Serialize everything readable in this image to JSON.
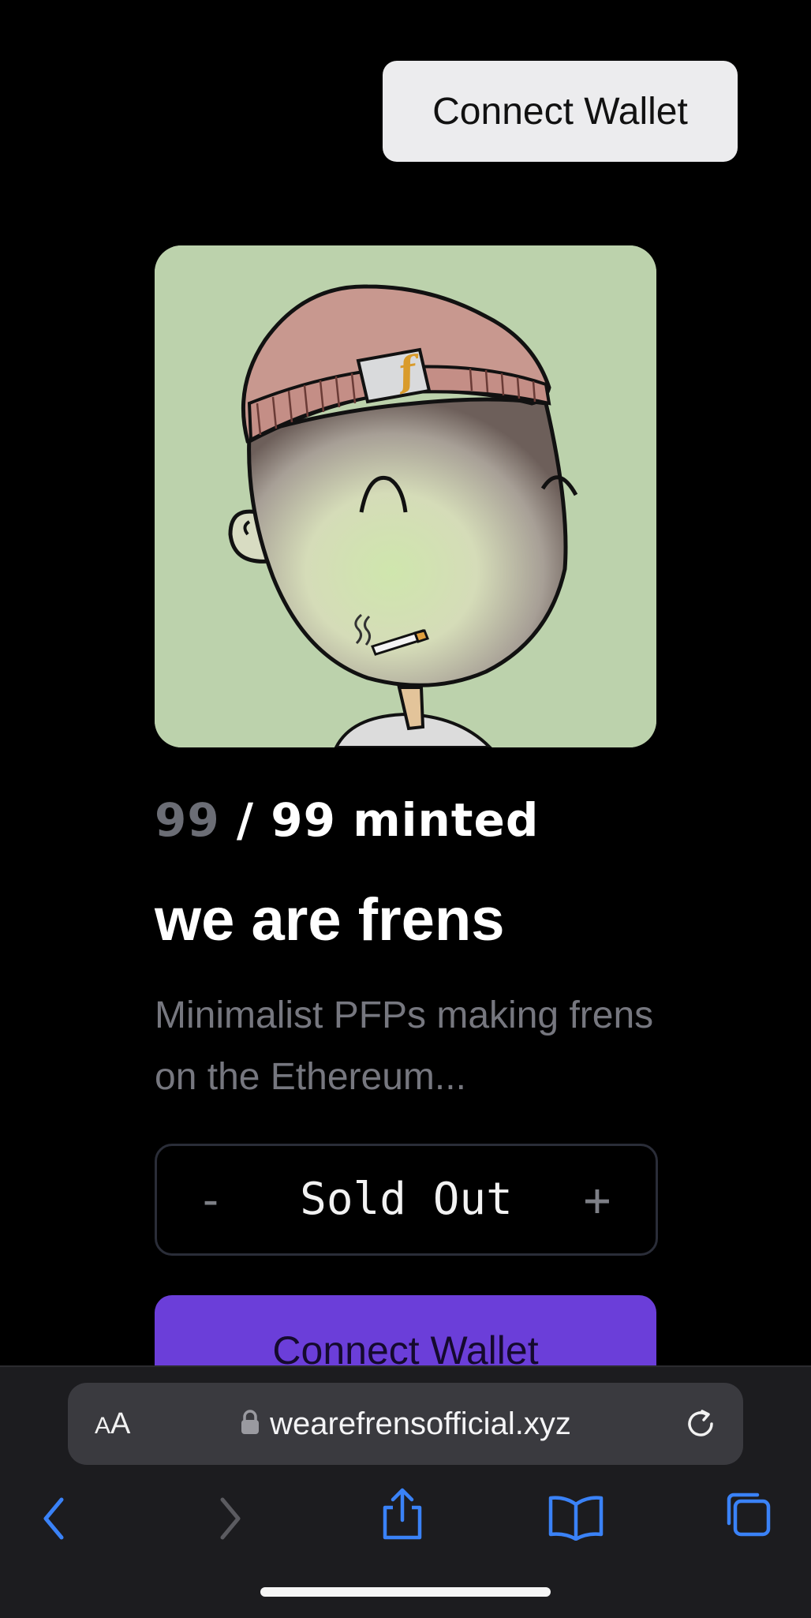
{
  "header": {
    "connect_label": "Connect Wallet"
  },
  "collection": {
    "minted_count": "99",
    "minted_total": " / 99 minted",
    "title": "we are frens",
    "description": "Minimalist PFPs making frens on the Ethereum...",
    "hat_letter": "f"
  },
  "quantity": {
    "minus_label": "-",
    "status_label": "Sold Out",
    "plus_label": "+"
  },
  "mint": {
    "connect_label": "Connect Wallet"
  },
  "browser": {
    "text_size_small": "A",
    "text_size_large": "A",
    "url": "wearefrensofficial.xyz"
  },
  "colors": {
    "background": "#000000",
    "accent_purple": "#6b3ed9",
    "muted_text": "#76777f",
    "browser_blue": "#3a82f7",
    "image_bg": "#bcd2ac"
  },
  "icons": {
    "back": "chevron-left-icon",
    "forward": "chevron-right-icon",
    "share": "share-icon",
    "bookmarks": "book-icon",
    "tabs": "tabs-icon",
    "lock": "lock-icon",
    "reload": "reload-icon"
  }
}
